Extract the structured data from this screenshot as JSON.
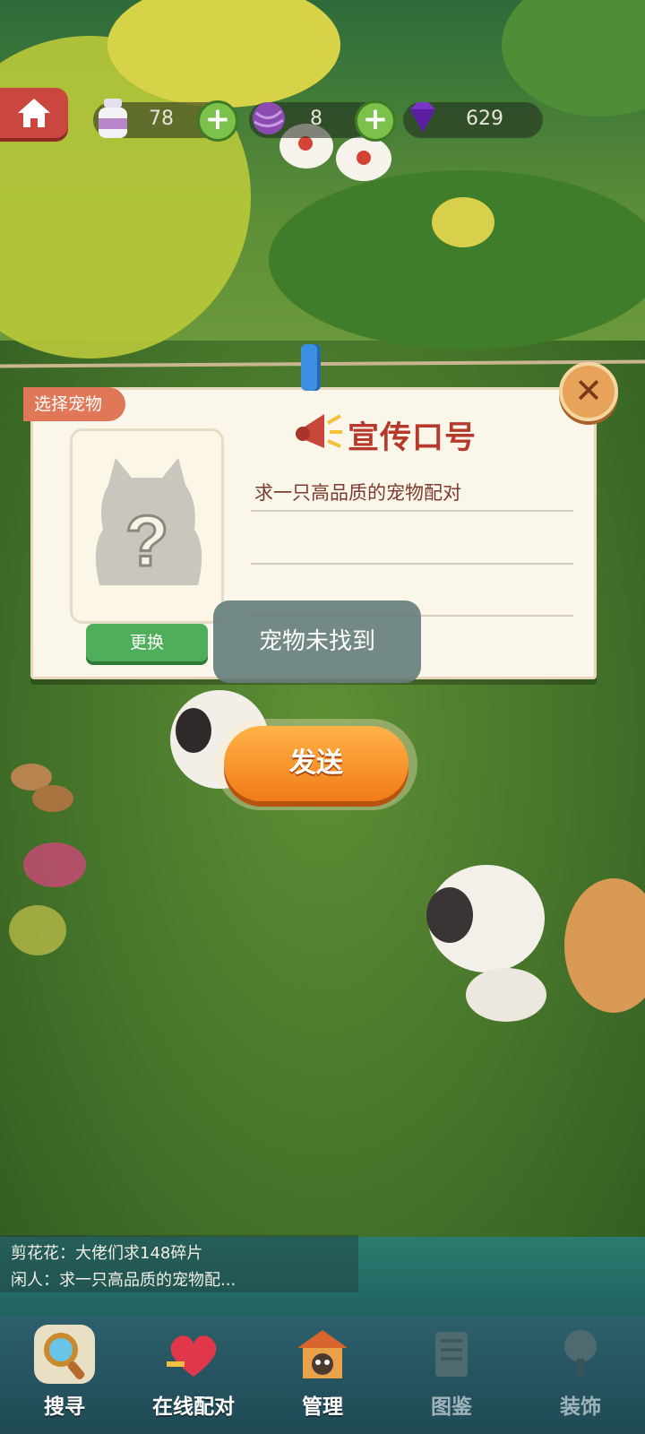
{
  "resources": [
    {
      "icon": "milk-bottle-icon",
      "value": "78"
    },
    {
      "icon": "yarn-ball-icon",
      "value": "8"
    },
    {
      "icon": "purple-gem-icon",
      "value": "629"
    }
  ],
  "dialog": {
    "tag_label": "选择宠物",
    "slogan_title": "宣传口号",
    "slogan_text": "求一只高品质的宠物配对",
    "change_label": "更换",
    "send_label": "发送",
    "close_icon": "close-icon"
  },
  "toast": "宠物未找到",
  "chat": [
    "剪花花：大佬们求148碎片",
    "闲人：求一只高品质的宠物配..."
  ],
  "nav": [
    {
      "label": "搜寻",
      "icon": "magnifier-icon"
    },
    {
      "label": "在线配对",
      "icon": "heart-icon"
    },
    {
      "label": "管理",
      "icon": "pet-house-icon"
    },
    {
      "label": "图鉴",
      "icon": "book-icon"
    },
    {
      "label": "装饰",
      "icon": "tree-icon"
    }
  ],
  "colors": {
    "accent": "#f17b18",
    "title": "#b53a2c",
    "change": "#4fae5a"
  }
}
